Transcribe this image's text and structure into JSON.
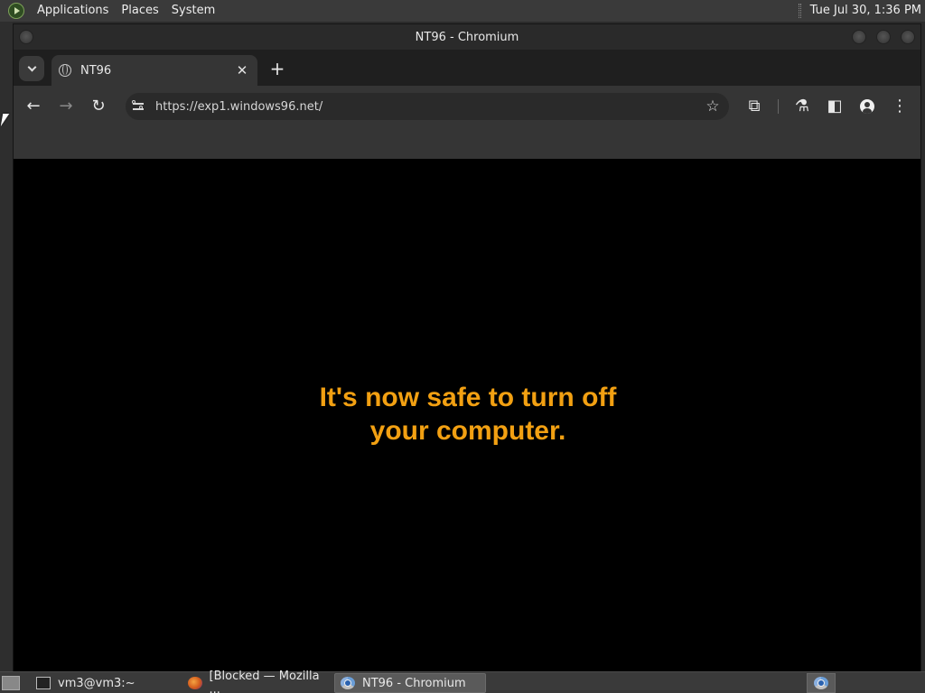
{
  "top_panel": {
    "menus": [
      "Applications",
      "Places",
      "System"
    ],
    "clock": "Tue Jul 30,  1:36 PM"
  },
  "window": {
    "title": "NT96 - Chromium"
  },
  "tabs": [
    {
      "title": "NT96",
      "close": "✕"
    }
  ],
  "new_tab_label": "+",
  "toolbar": {
    "back": "←",
    "forward": "→",
    "reload": "↻",
    "url": "https://exp1.windows96.net/",
    "bookmark_star": "☆",
    "extensions": "⧉",
    "labs": "⚗",
    "side_panel": "◧",
    "menu": "⋮"
  },
  "page": {
    "message_line1": "It's now safe to turn off",
    "message_line2": "your computer."
  },
  "taskbar": {
    "items": [
      {
        "label": "vm3@vm3:~",
        "icon": "terminal-icon",
        "active": false
      },
      {
        "label": "[Blocked — Mozilla ...",
        "icon": "firefox-icon",
        "active": false
      },
      {
        "label": "NT96 - Chromium",
        "icon": "chromium-icon",
        "active": true
      }
    ]
  }
}
